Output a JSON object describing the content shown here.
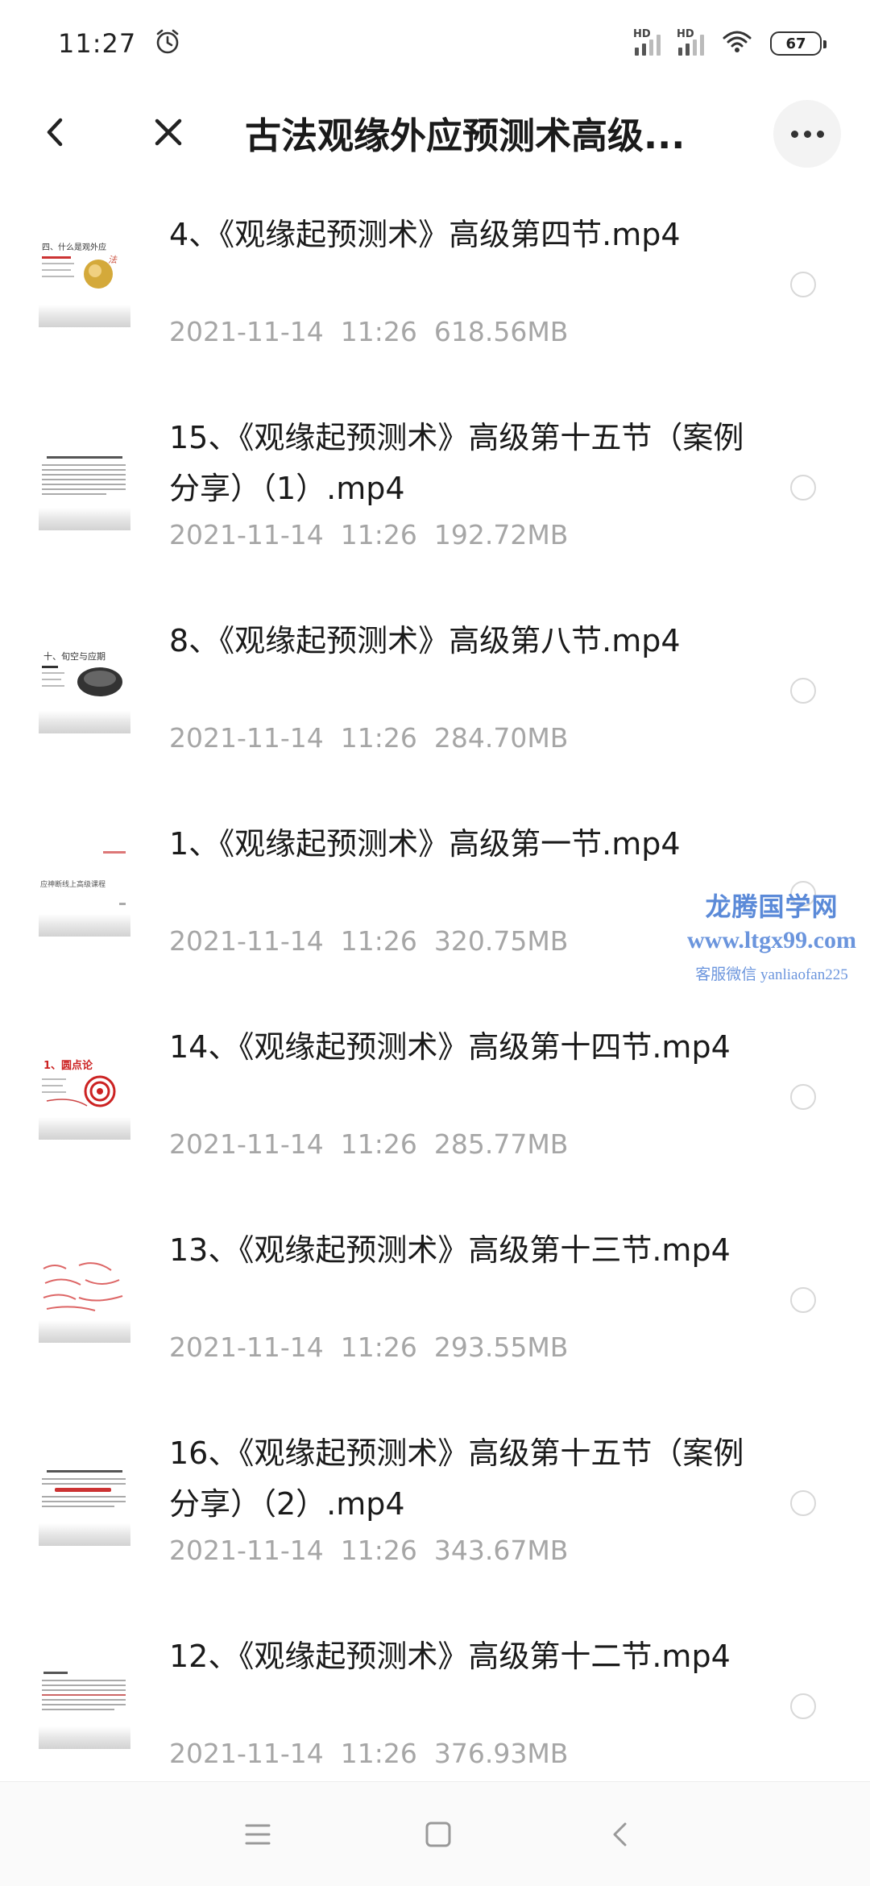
{
  "status_bar": {
    "time": "11:27",
    "alarm_icon": "alarm-clock-icon",
    "signal_label": "HD",
    "battery": "67"
  },
  "header": {
    "title": "古法观缘外应预测术高级..."
  },
  "files": [
    {
      "name": "4、《观缘起预测术》高级第四节.mp4",
      "date": "2021-11-14",
      "time": "11:26",
      "size": "618.56MB"
    },
    {
      "name": "15、《观缘起预测术》高级第十五节（案例分享）（1）.mp4",
      "date": "2021-11-14",
      "time": "11:26",
      "size": "192.72MB"
    },
    {
      "name": "8、《观缘起预测术》高级第八节.mp4",
      "date": "2021-11-14",
      "time": "11:26",
      "size": "284.70MB"
    },
    {
      "name": "1、《观缘起预测术》高级第一节.mp4",
      "date": "2021-11-14",
      "time": "11:26",
      "size": "320.75MB"
    },
    {
      "name": "14、《观缘起预测术》高级第十四节.mp4",
      "date": "2021-11-14",
      "time": "11:26",
      "size": "285.77MB"
    },
    {
      "name": "13、《观缘起预测术》高级第十三节.mp4",
      "date": "2021-11-14",
      "time": "11:26",
      "size": "293.55MB"
    },
    {
      "name": "16、《观缘起预测术》高级第十五节（案例分享）（2）.mp4",
      "date": "2021-11-14",
      "time": "11:26",
      "size": "343.67MB"
    },
    {
      "name": "12、《观缘起预测术》高级第十二节.mp4",
      "date": "2021-11-14",
      "time": "11:26",
      "size": "376.93MB"
    }
  ],
  "thumbnails": [
    {
      "caption": "四、什么是观外应"
    },
    {
      "caption": ""
    },
    {
      "caption": "十、旬空与应期"
    },
    {
      "caption": "应神断线上高级课程"
    },
    {
      "caption": "1、圆点论"
    },
    {
      "caption": ""
    },
    {
      "caption": ""
    },
    {
      "caption": ""
    }
  ],
  "watermark": {
    "line1": "龙腾国学网",
    "line2": "www.ltgx99.com",
    "line3": "客服微信 yanliaofan225"
  },
  "colors": {
    "meta_text": "#a6a6a6",
    "watermark": "#5b8ad8"
  }
}
